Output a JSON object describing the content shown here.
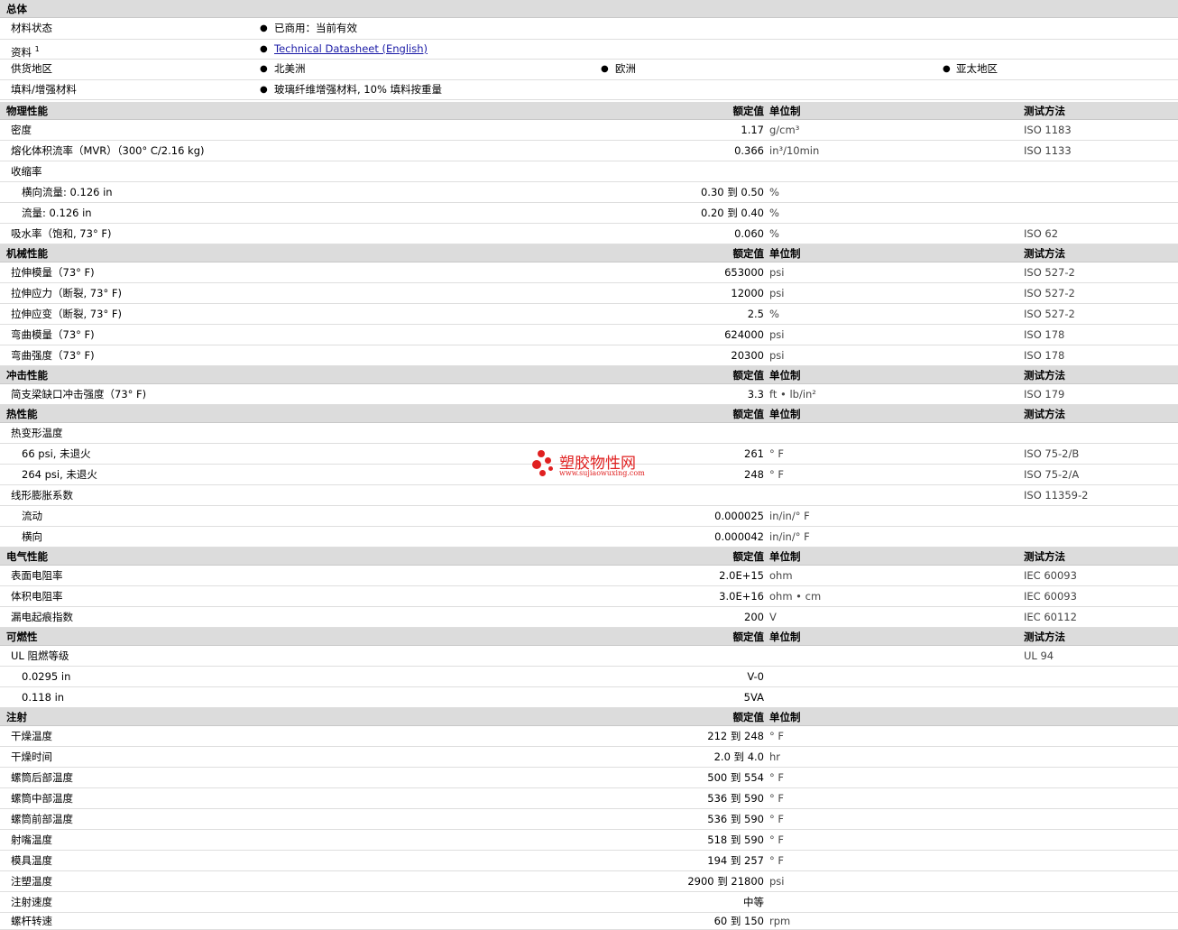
{
  "general": {
    "title": "总体",
    "material_status": {
      "label": "材料状态",
      "value": "已商用：当前有效"
    },
    "documents": {
      "label": "资料",
      "sup": "1",
      "link": "Technical Datasheet (English)"
    },
    "regions": {
      "label": "供货地区",
      "items": [
        "北美洲",
        "欧洲",
        "亚太地区"
      ]
    },
    "filler": {
      "label": "填料/增强材料",
      "value": "玻璃纤维增强材料, 10% 填料按重量"
    }
  },
  "columns": {
    "nominal": "额定值",
    "unit": "单位制",
    "test": "测试方法"
  },
  "sections": [
    {
      "title": "物理性能",
      "rows": [
        {
          "label": "密度",
          "value": "1.17",
          "unit": "g/cm³",
          "method": "ISO 1183"
        },
        {
          "label": "熔化体积流率（MVR）（300° C/2.16 kg)",
          "value": "0.366",
          "unit": "in³/10min",
          "method": "ISO 1133"
        },
        {
          "label": "收缩率",
          "value": "",
          "unit": "",
          "method": ""
        },
        {
          "label": "横向流量: 0.126 in",
          "value": "0.30 到  0.50",
          "unit": "%",
          "method": ""
        },
        {
          "label": "流量: 0.126 in",
          "value": "0.20 到  0.40",
          "unit": "%",
          "method": ""
        },
        {
          "label": "吸水率（饱和, 73° F)",
          "value": "0.060",
          "unit": "%",
          "method": "ISO 62"
        }
      ]
    },
    {
      "title": "机械性能",
      "rows": [
        {
          "label": "拉伸模量（73° F)",
          "value": "653000",
          "unit": "psi",
          "method": "ISO 527-2"
        },
        {
          "label": "拉伸应力（断裂, 73° F)",
          "value": "12000",
          "unit": "psi",
          "method": "ISO 527-2"
        },
        {
          "label": "拉伸应变（断裂, 73° F)",
          "value": "2.5",
          "unit": "%",
          "method": "ISO 527-2"
        },
        {
          "label": "弯曲模量（73° F)",
          "value": "624000",
          "unit": "psi",
          "method": "ISO 178"
        },
        {
          "label": "弯曲强度（73° F)",
          "value": "20300",
          "unit": "psi",
          "method": "ISO 178"
        }
      ]
    },
    {
      "title": "冲击性能",
      "rows": [
        {
          "label": "简支梁缺口冲击强度（73° F)",
          "value": "3.3",
          "unit": "ft • lb/in²",
          "method": "ISO 179"
        }
      ]
    },
    {
      "title": "热性能",
      "rows": [
        {
          "label": "热变形温度",
          "value": "",
          "unit": "",
          "method": ""
        },
        {
          "label": "66 psi, 未退火",
          "value": "261",
          "unit": "° F",
          "method": "ISO 75-2/B"
        },
        {
          "label": "264 psi, 未退火",
          "value": "248",
          "unit": "° F",
          "method": "ISO 75-2/A"
        },
        {
          "label": "线形膨胀系数",
          "value": "",
          "unit": "",
          "method": "ISO 11359-2"
        },
        {
          "label": "流动",
          "value": "0.000025",
          "unit": "in/in/° F",
          "method": ""
        },
        {
          "label": "横向",
          "value": "0.000042",
          "unit": "in/in/° F",
          "method": ""
        }
      ]
    },
    {
      "title": "电气性能",
      "rows": [
        {
          "label": "表面电阻率",
          "value": "2.0E+15",
          "unit": "ohm",
          "method": "IEC 60093"
        },
        {
          "label": "体积电阻率",
          "value": "3.0E+16",
          "unit": "ohm • cm",
          "method": "IEC 60093"
        },
        {
          "label": "漏电起痕指数",
          "value": "200",
          "unit": "V",
          "method": "IEC 60112"
        }
      ]
    },
    {
      "title": "可燃性",
      "rows": [
        {
          "label": "UL 阻燃等级",
          "value": "",
          "unit": "",
          "method": "UL 94"
        },
        {
          "label": "0.0295 in",
          "value": "V-0",
          "unit": "",
          "method": ""
        },
        {
          "label": "0.118 in",
          "value": "5VA",
          "unit": "",
          "method": ""
        }
      ]
    },
    {
      "title": "注射",
      "rows": [
        {
          "label": "干燥温度",
          "value": "212 到  248",
          "unit": "° F",
          "method": ""
        },
        {
          "label": "干燥时间",
          "value": "2.0 到  4.0",
          "unit": "hr",
          "method": ""
        },
        {
          "label": "螺筒后部温度",
          "value": "500 到  554",
          "unit": "° F",
          "method": ""
        },
        {
          "label": "螺筒中部温度",
          "value": "536 到  590",
          "unit": "° F",
          "method": ""
        },
        {
          "label": "螺筒前部温度",
          "value": "536 到  590",
          "unit": "° F",
          "method": ""
        },
        {
          "label": "射嘴温度",
          "value": "518 到  590",
          "unit": "° F",
          "method": ""
        },
        {
          "label": "模具温度",
          "value": "194 到  257",
          "unit": "° F",
          "method": ""
        },
        {
          "label": "注塑温度",
          "value": "2900 到  21800",
          "unit": "psi",
          "method": ""
        },
        {
          "label": "注射速度",
          "value": "中等",
          "unit": "",
          "method": ""
        },
        {
          "label": "螺杆转速",
          "value": "60 到  150",
          "unit": "rpm",
          "method": ""
        }
      ]
    }
  ],
  "watermark": {
    "text": "塑胶物性网",
    "url": "www.sujiaowuxing.com"
  },
  "colors": {
    "header_bg": "#dcdcdc",
    "link": "#1a1aa6",
    "watermark": "#e02020"
  }
}
